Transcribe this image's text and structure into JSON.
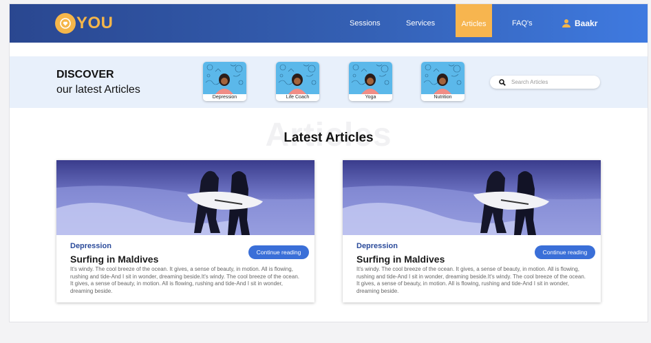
{
  "brand": {
    "logo_text": "YOU",
    "accent": "#f5b64a",
    "nav_blue": "#2a4790"
  },
  "nav": {
    "sessions": "Sessions",
    "services": "Services",
    "articles": "Articles",
    "faq": "FAQ's",
    "user": "Baakr",
    "user_icon": "user-icon"
  },
  "discover": {
    "title": "DISCOVER",
    "subtitle": "our latest Articles",
    "categories": [
      {
        "label": "Depression"
      },
      {
        "label": "Life Coach"
      },
      {
        "label": "Yoga"
      },
      {
        "label": "Nutrition"
      }
    ],
    "search_placeholder": "Search Articles",
    "search_icon": "search-icon"
  },
  "latest": {
    "ghost": "Articles",
    "title": "Latest Articles"
  },
  "articles": [
    {
      "category": "Depression",
      "title": "Surfing in Maldives",
      "body": "It's windy. The cool breeze of the ocean. It gives, a sense of beauty, in motion. All is flowing, rushing and tide-And I sit in wonder, dreaming beside.It's windy. The cool breeze of the ocean. It gives, a sense of beauty, in motion. All is flowing, rushing and tide-And I sit in wonder, dreaming beside.",
      "button": "Continue reading"
    },
    {
      "category": "Depression",
      "title": "Surfing in Maldives",
      "body": "It's windy. The cool breeze of the ocean. It gives, a sense of beauty, in motion. All is flowing, rushing and tide-And I sit in wonder, dreaming beside.It's windy. The cool breeze of the ocean. It gives, a sense of beauty, in motion. All is flowing, rushing and tide-And I sit in wonder, dreaming beside.",
      "button": "Continue reading"
    }
  ]
}
